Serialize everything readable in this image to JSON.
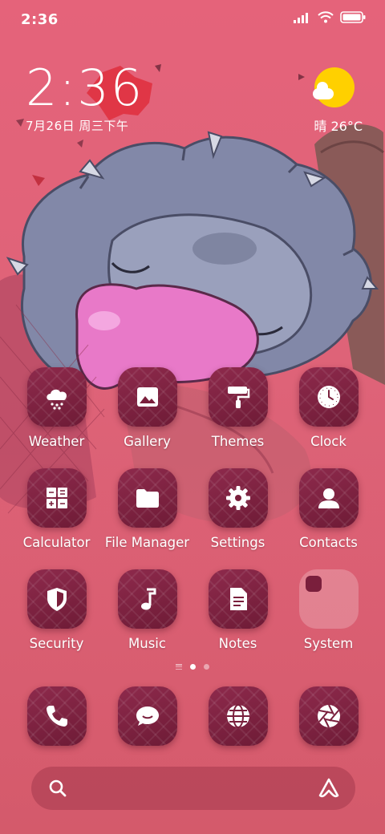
{
  "status_bar": {
    "time": "2:36",
    "icons": [
      "signal-icon",
      "wifi-icon",
      "battery-icon"
    ]
  },
  "clock_widget": {
    "time": "2:36",
    "date": "7月26日 周三下午"
  },
  "weather_widget": {
    "condition": "晴",
    "temperature": "26°C",
    "icon": "sunny-cloud-icon"
  },
  "apps": [
    {
      "label": "Weather",
      "icon": "weather-icon"
    },
    {
      "label": "Gallery",
      "icon": "gallery-icon"
    },
    {
      "label": "Themes",
      "icon": "paint-roller-icon"
    },
    {
      "label": "Clock",
      "icon": "clock-icon"
    },
    {
      "label": "Calculator",
      "icon": "calculator-icon"
    },
    {
      "label": "File Manager",
      "icon": "folder-icon"
    },
    {
      "label": "Settings",
      "icon": "gear-icon"
    },
    {
      "label": "Contacts",
      "icon": "contact-icon"
    },
    {
      "label": "Security",
      "icon": "shield-icon"
    },
    {
      "label": "Music",
      "icon": "music-note-icon"
    },
    {
      "label": "Notes",
      "icon": "note-icon"
    },
    {
      "label": "System",
      "icon": "folder-icon"
    }
  ],
  "page_indicator": {
    "pages": 2,
    "current": 1
  },
  "dock": [
    {
      "name": "Phone",
      "icon": "phone-icon"
    },
    {
      "name": "Messages",
      "icon": "chat-icon"
    },
    {
      "name": "Browser",
      "icon": "globe-icon"
    },
    {
      "name": "Camera",
      "icon": "shutter-icon"
    }
  ],
  "search_bar": {
    "icons": [
      "search-icon",
      "assistant-icon"
    ]
  },
  "colors": {
    "background": "#e5637a",
    "tile": "#7a1f3c",
    "sun": "#ffd000",
    "text": "#ffffff"
  }
}
